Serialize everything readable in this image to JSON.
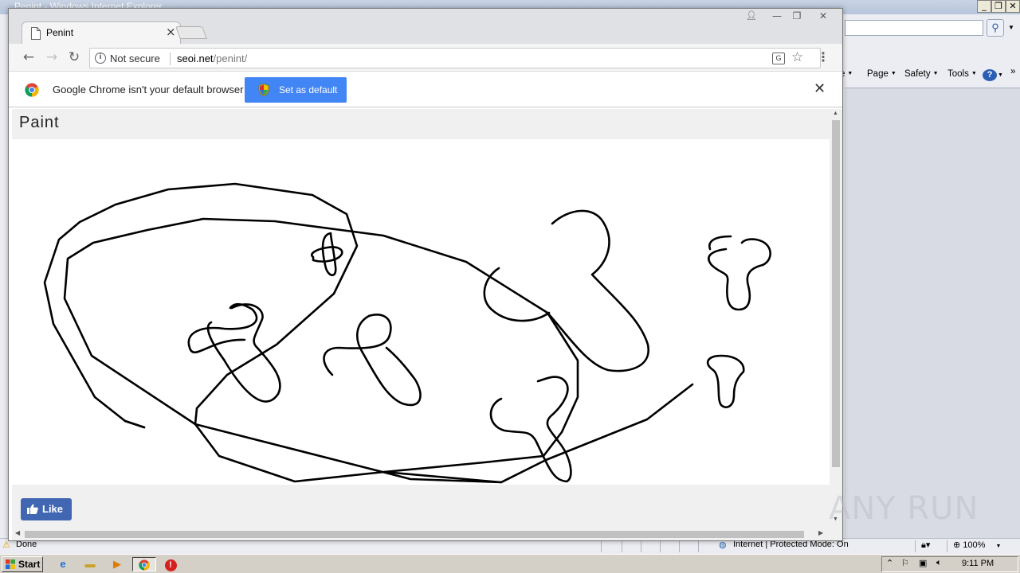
{
  "ie": {
    "title": "Penint - Windows Internet Explorer",
    "command_bar": {
      "page_label": "Page",
      "safety_label": "Safety",
      "tools_label": "Tools",
      "help_label": "?"
    },
    "status_bar": {
      "status_text": "Done",
      "zone_text": "Internet | Protected Mode: On",
      "zoom_text": "100%"
    }
  },
  "taskbar": {
    "start_label": "Start",
    "clock": "9:11 PM"
  },
  "chrome": {
    "tab_title": "Penint",
    "omnibox": {
      "security_label": "Not secure",
      "url_host": "seoi.net",
      "url_path": "/penint/"
    },
    "infobar": {
      "message": "Google Chrome isn't your default browser",
      "button_label": "Set as default"
    }
  },
  "page": {
    "title": "Paint",
    "like_label": "Like"
  },
  "watermark": {
    "text": "ANY RUN"
  },
  "colors": {
    "accent_blue": "#4285f4",
    "facebook_blue": "#4267b2",
    "stroke": "#000000"
  },
  "icons": [
    "page-icon",
    "close-icon",
    "back-arrow-icon",
    "forward-arrow-icon",
    "reload-icon",
    "info-icon",
    "translate-icon",
    "star-icon",
    "menu-icon",
    "chrome-logo-icon",
    "shield-icon",
    "thumbs-up-icon",
    "search-icon",
    "windows-logo-icon"
  ]
}
